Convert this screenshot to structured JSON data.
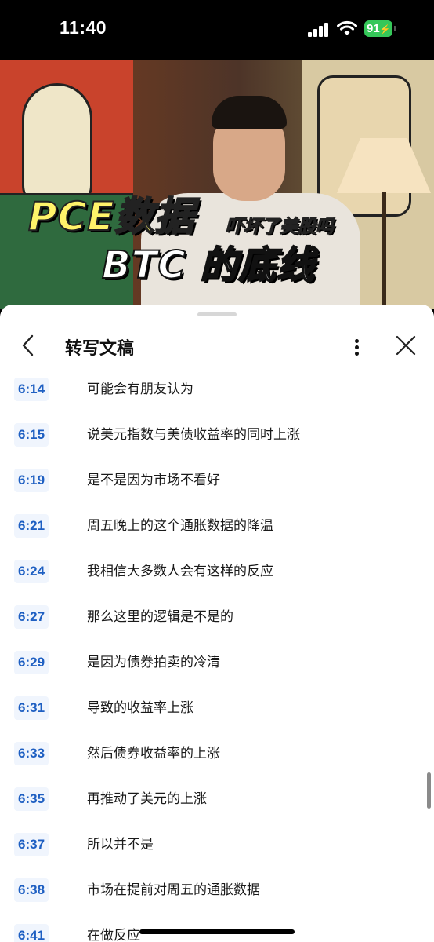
{
  "status_bar": {
    "time": "11:40",
    "battery": "91"
  },
  "video": {
    "title_main": "PCE数据",
    "title_sub": "吓坏了美股吗",
    "title_line2": "BTC 的底线"
  },
  "panel": {
    "title": "转写文稿"
  },
  "transcript": [
    {
      "time": "6:14",
      "text": "可能会有朋友认为"
    },
    {
      "time": "6:15",
      "text": "说美元指数与美债收益率的同时上涨"
    },
    {
      "time": "6:19",
      "text": "是不是因为市场不看好"
    },
    {
      "time": "6:21",
      "text": "周五晚上的这个通胀数据的降温"
    },
    {
      "time": "6:24",
      "text": "我相信大多数人会有这样的反应"
    },
    {
      "time": "6:27",
      "text": "那么这里的逻辑是不是的"
    },
    {
      "time": "6:29",
      "text": "是因为债券拍卖的冷清"
    },
    {
      "time": "6:31",
      "text": "导致的收益率上涨"
    },
    {
      "time": "6:33",
      "text": "然后债券收益率的上涨"
    },
    {
      "time": "6:35",
      "text": "再推动了美元的上涨"
    },
    {
      "time": "6:37",
      "text": "所以并不是"
    },
    {
      "time": "6:38",
      "text": "市场在提前对周五的通胀数据"
    },
    {
      "time": "6:41",
      "text": "在做反应"
    }
  ],
  "colors": {
    "timestamp": "#1e5fc2",
    "timestamp_bg": "#f0f5fd",
    "battery": "#35c759",
    "title_yellow": "#fff36a"
  },
  "icons": [
    "signal-icon",
    "wifi-icon",
    "battery-icon",
    "back-chevron-icon",
    "more-vertical-icon",
    "close-icon"
  ]
}
